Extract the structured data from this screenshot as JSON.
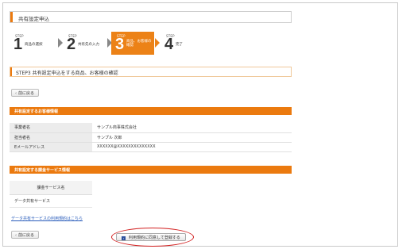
{
  "header": {
    "title": "共有設定申込"
  },
  "steps": [
    {
      "tag": "STEP",
      "number": "1",
      "label": "商品の選択",
      "active": false
    },
    {
      "tag": "STEP",
      "number": "2",
      "label": "共有先の入力",
      "active": false
    },
    {
      "tag": "STEP",
      "number": "3",
      "label_line1": "商品、お客様の",
      "label_line2": "確認",
      "active": true
    },
    {
      "tag": "STEP",
      "number": "4",
      "label": "完了",
      "active": false
    }
  ],
  "section_heading": "STEP3 共有設定申込をする商品、お客様の確認",
  "back_button_label": "前に戻る",
  "customer_info": {
    "heading": "共有設定するお客様情報",
    "rows": [
      {
        "key": "事業者名",
        "value": "サンプル商事株式会社"
      },
      {
        "key": "担当者名",
        "value": "サンプル 次郎"
      },
      {
        "key": "Eメールアドレス",
        "value": "XXXXXX@XXXXXXXXXXXXXX"
      }
    ]
  },
  "service_info": {
    "heading": "共有設定する課金サービス情報",
    "column_header": "課金サービス名",
    "rows": [
      "データ共有サービス"
    ]
  },
  "terms_link": "データ共有サービスの利用規約はこちら",
  "agree_button_label": "利用規約に同意して登録する",
  "colors": {
    "accent": "#eb7a0f",
    "link": "#2a5dbb",
    "highlight": "#d21f1f"
  }
}
